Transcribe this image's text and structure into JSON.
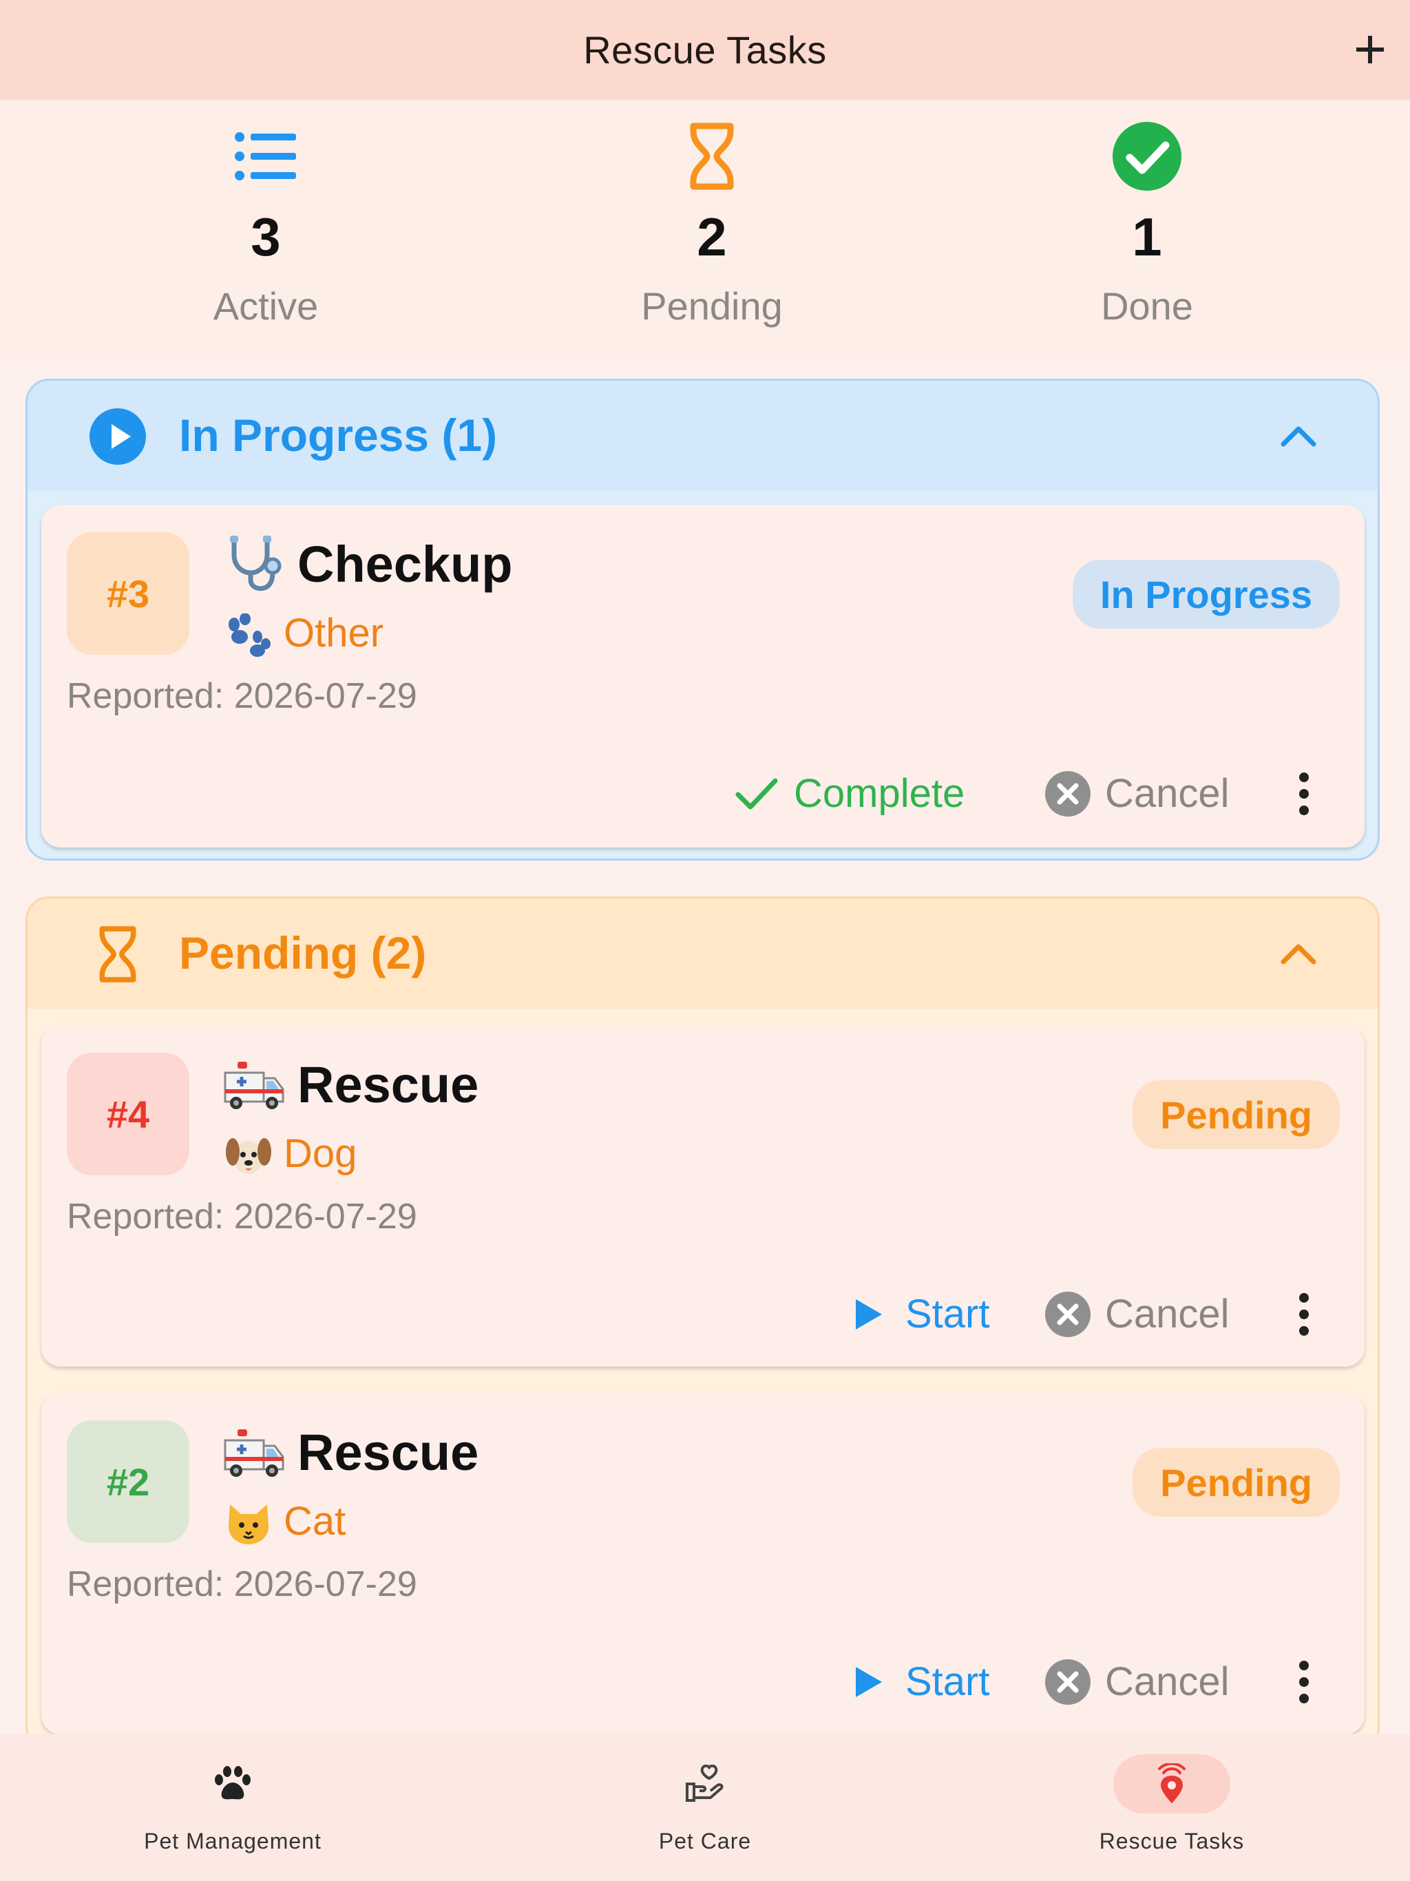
{
  "app_bar": {
    "title": "Rescue Tasks",
    "add_icon": "plus-icon"
  },
  "stats": [
    {
      "icon": "list-icon",
      "count": "3",
      "label": "Active",
      "color": "#2196f3"
    },
    {
      "icon": "hourglass-icon",
      "count": "2",
      "label": "Pending",
      "color": "#f7931e"
    },
    {
      "icon": "check-circle-icon",
      "count": "1",
      "label": "Done",
      "color": "#22b14c"
    }
  ],
  "sections": {
    "in_progress": {
      "title": "In Progress (1)",
      "icon": "play-circle-icon",
      "color": "#2094ec",
      "cards": [
        {
          "id": "#3",
          "task_icon": "stethoscope-icon",
          "title": "Checkup",
          "animal_icon": "paw-icon",
          "animal": "Other",
          "reported": "Reported: 2026-07-29",
          "status": "In Progress",
          "primary_action": "Complete",
          "cancel_action": "Cancel"
        }
      ]
    },
    "pending": {
      "title": "Pending (2)",
      "icon": "hourglass-icon",
      "color": "#f28a12",
      "cards": [
        {
          "id": "#4",
          "task_icon": "ambulance-icon",
          "title": "Rescue",
          "animal_icon": "dog-face-icon",
          "animal": "Dog",
          "reported": "Reported: 2026-07-29",
          "status": "Pending",
          "primary_action": "Start",
          "cancel_action": "Cancel"
        },
        {
          "id": "#2",
          "task_icon": "ambulance-icon",
          "title": "Rescue",
          "animal_icon": "cat-face-icon",
          "animal": "Cat",
          "reported": "Reported: 2026-07-29",
          "status": "Pending",
          "primary_action": "Start",
          "cancel_action": "Cancel"
        }
      ]
    }
  },
  "bottom_nav": [
    {
      "label": "Pet Management",
      "icon": "paw-icon",
      "active": false
    },
    {
      "label": "Pet Care",
      "icon": "hand-heart-icon",
      "active": false
    },
    {
      "label": "Rescue Tasks",
      "icon": "location-signal-icon",
      "active": true
    }
  ]
}
